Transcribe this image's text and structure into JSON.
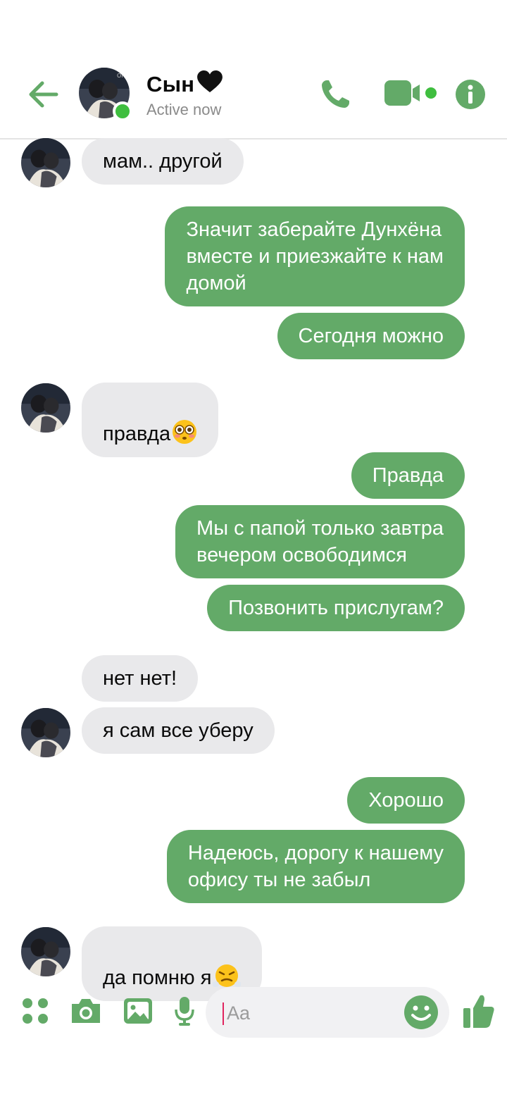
{
  "header": {
    "contact_name": "Сын",
    "status": "Active now"
  },
  "colors": {
    "accent": "#63aa68",
    "incoming_bubble": "#e9e9eb",
    "online": "#3fbe3f"
  },
  "icons": [
    "back-arrow-icon",
    "phone-icon",
    "video-camera-icon",
    "info-icon",
    "apps-grid-icon",
    "camera-icon",
    "gallery-icon",
    "microphone-icon",
    "emoji-smile-icon",
    "thumbs-up-icon",
    "black-heart-icon"
  ],
  "messages": [
    {
      "dir": "in",
      "text": "мам.. другой"
    },
    {
      "dir": "out",
      "text": "Значит заберайте Дунхёна\nвместе и приезжайте к нам\nдомой"
    },
    {
      "dir": "out",
      "text": "Сегодня можно"
    },
    {
      "dir": "in",
      "text": "правда",
      "emoji": "flushed-face"
    },
    {
      "dir": "out",
      "text": "Правда"
    },
    {
      "dir": "out",
      "text": "Мы с папой только завтра\nвечером освободимся"
    },
    {
      "dir": "out",
      "text": "Позвонить прислугам?"
    },
    {
      "dir": "in",
      "text": "нет нет!"
    },
    {
      "dir": "in",
      "text": "я сам все уберу"
    },
    {
      "dir": "out",
      "text": "Хорошо"
    },
    {
      "dir": "out",
      "text": "Надеюсь, дорогу к нашему\nофису ты не забыл"
    },
    {
      "dir": "in",
      "text": "да помню я",
      "emoji": "steam-from-nose-face"
    }
  ],
  "composer": {
    "placeholder": "Aa"
  }
}
